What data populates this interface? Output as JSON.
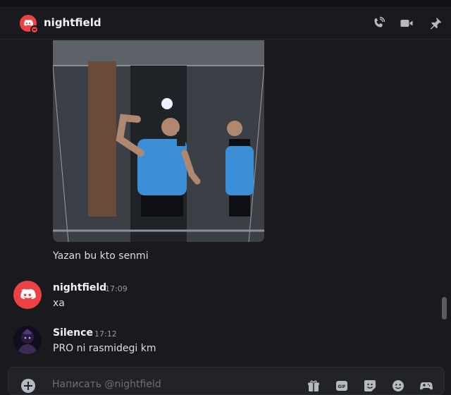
{
  "header": {
    "title": "nightfield",
    "icons": [
      "call-icon",
      "video-icon",
      "pin-icon"
    ]
  },
  "messages": {
    "image_caption": "Yazan bu kto senmi",
    "items": [
      {
        "author": "nightfield",
        "time": "17:09",
        "text": "xa",
        "avatar": "discord-logo"
      },
      {
        "author": "Silence",
        "time": "17:12",
        "text": "PRO ni rasmidegi km",
        "avatar": "dark-character"
      }
    ]
  },
  "composer": {
    "placeholder": "Написать @nightfield",
    "icons": [
      "add-icon",
      "gift-icon",
      "gif-icon",
      "sticker-icon",
      "emoji-icon",
      "game-icon"
    ]
  },
  "colors": {
    "background": "#1a1a1e",
    "brand": "#ed4245",
    "status_dnd": "#f23f43"
  }
}
